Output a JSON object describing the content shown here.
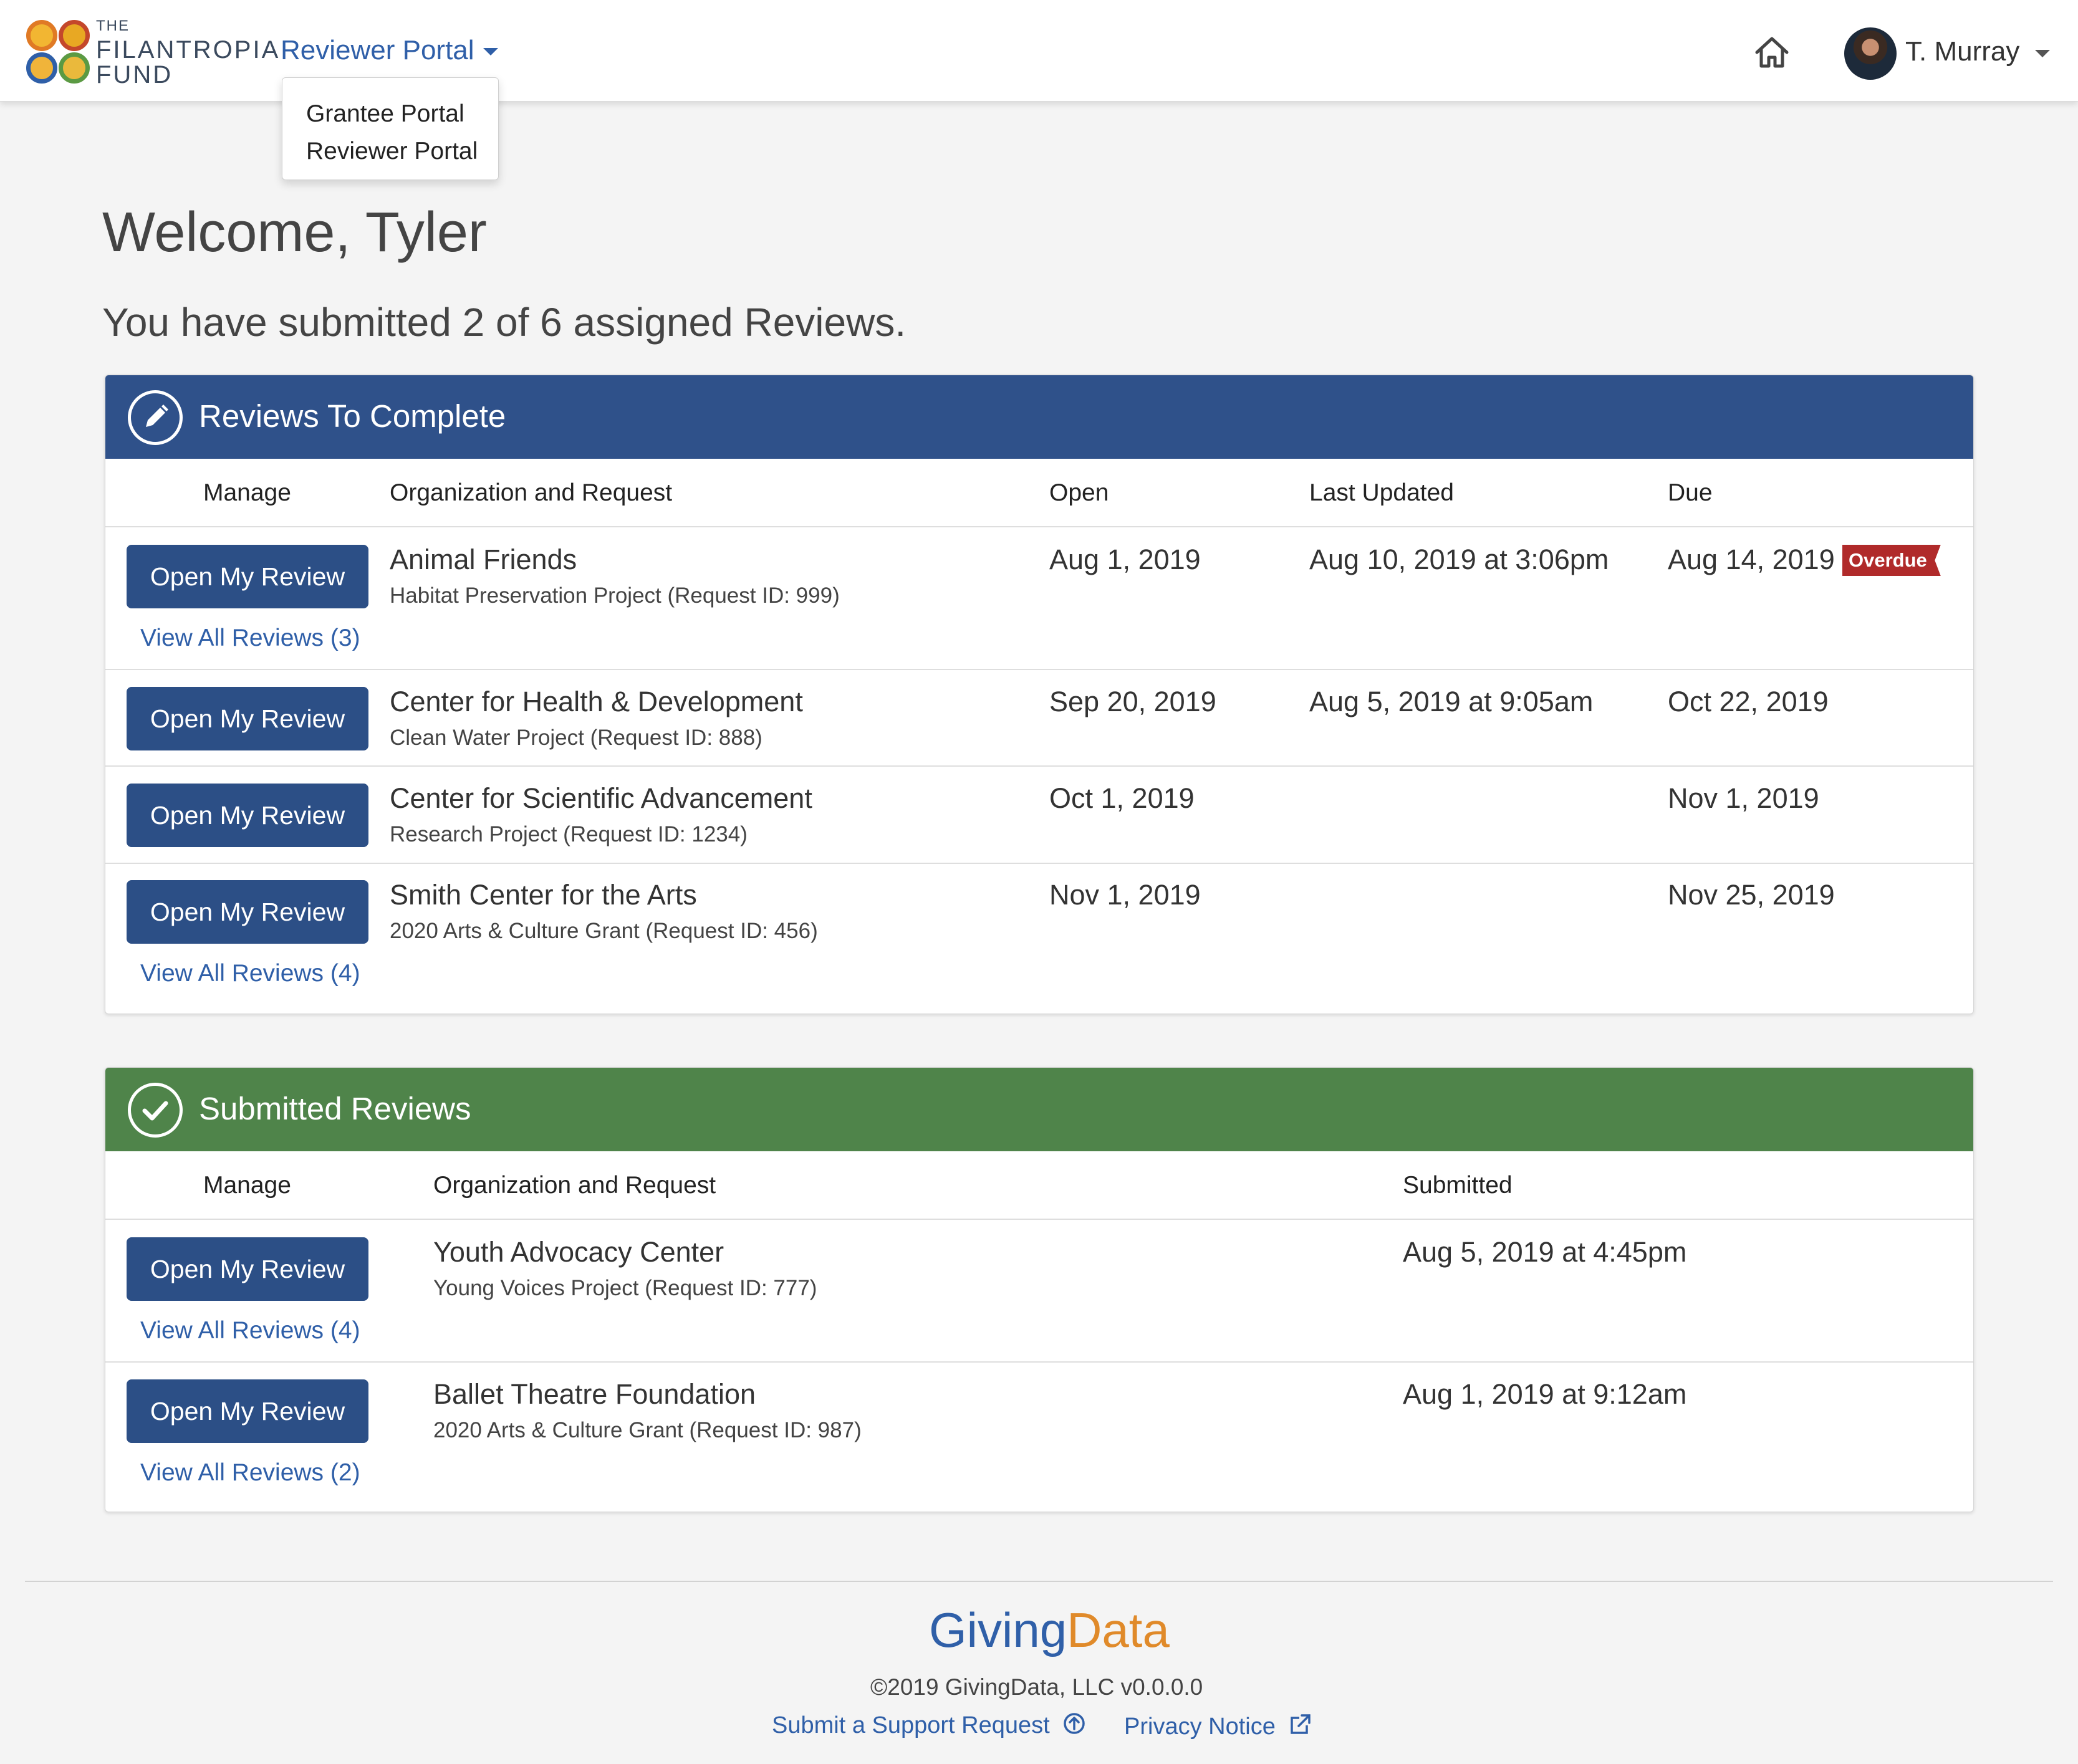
{
  "brand": {
    "line1": "THE",
    "line2": "FILANTROPIA",
    "line3": "FUND"
  },
  "nav": {
    "portal_label": "Reviewer Portal",
    "dropdown": [
      "Grantee Portal",
      "Reviewer Portal"
    ],
    "user_name": "T. Murray",
    "home_icon": "home-icon",
    "accent_color": "#2f5fa8"
  },
  "welcome": "Welcome, Tyler",
  "summary": "You have submitted 2 of 6 assigned Reviews.",
  "to_complete": {
    "title": "Reviews To Complete",
    "header_color": "#2f518a",
    "columns": [
      "Manage",
      "Organization and Request",
      "Open",
      "Last Updated",
      "Due"
    ],
    "rows": [
      {
        "button": "Open My Review",
        "view_all": "View All Reviews (3)",
        "org": "Animal Friends",
        "request": "Habitat Preservation Project (Request ID: 999)",
        "open": "Aug 1, 2019",
        "last_updated": "Aug 10, 2019 at 3:06pm",
        "due": "Aug 14, 2019",
        "badge": "Overdue"
      },
      {
        "button": "Open My Review",
        "org": "Center for Health & Development",
        "request": "Clean Water Project (Request ID: 888)",
        "open": "Sep 20, 2019",
        "last_updated": "Aug 5, 2019 at 9:05am",
        "due": "Oct 22, 2019"
      },
      {
        "button": "Open My Review",
        "org": "Center for Scientific Advancement",
        "request": "Research Project (Request ID: 1234)",
        "open": "Oct 1, 2019",
        "last_updated": "",
        "due": "Nov 1, 2019"
      },
      {
        "button": "Open My Review",
        "view_all": "View All Reviews (4)",
        "org": "Smith Center for the Arts",
        "request": "2020 Arts & Culture Grant (Request ID: 456)",
        "open": "Nov 1, 2019",
        "last_updated": "",
        "due": "Nov 25, 2019"
      }
    ]
  },
  "submitted": {
    "title": "Submitted Reviews",
    "header_color": "#4f844a",
    "columns": [
      "Manage",
      "Organization and Request",
      "Submitted"
    ],
    "rows": [
      {
        "button": "Open My Review",
        "view_all": "View All Reviews (4)",
        "org": "Youth Advocacy Center",
        "request": "Young Voices Project (Request ID: 777)",
        "submitted": "Aug 5, 2019 at 4:45pm"
      },
      {
        "button": "Open My Review",
        "view_all": "View All Reviews (2)",
        "org": "Ballet Theatre Foundation",
        "request": "2020 Arts & Culture Grant (Request ID: 987)",
        "submitted": "Aug 1, 2019 at 9:12am"
      }
    ]
  },
  "footer": {
    "logo_part1": "Giving",
    "logo_part2": "Data",
    "copyright": "©2019 GivingData, LLC   v0.0.0.0",
    "support_link": "Submit a Support Request",
    "privacy_link": "Privacy Notice"
  }
}
